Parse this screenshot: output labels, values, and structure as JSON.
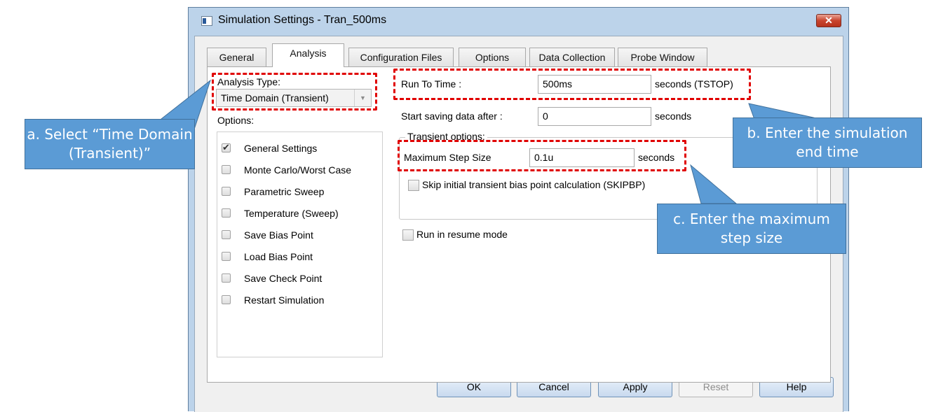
{
  "window": {
    "title": "Simulation Settings - Tran_500ms",
    "close_label": "✕"
  },
  "tabs": [
    {
      "label": "General"
    },
    {
      "label": "Analysis",
      "active": true
    },
    {
      "label": "Configuration Files"
    },
    {
      "label": "Options"
    },
    {
      "label": "Data Collection"
    },
    {
      "label": "Probe Window"
    }
  ],
  "analysis": {
    "type_label": "Analysis Type:",
    "type_value": "Time Domain (Transient)",
    "options_label": "Options:",
    "options": [
      {
        "label": "General Settings",
        "checked": true
      },
      {
        "label": "Monte Carlo/Worst Case",
        "checked": false
      },
      {
        "label": "Parametric Sweep",
        "checked": false
      },
      {
        "label": "Temperature (Sweep)",
        "checked": false
      },
      {
        "label": "Save Bias Point",
        "checked": false
      },
      {
        "label": "Load Bias Point",
        "checked": false
      },
      {
        "label": "Save Check Point",
        "checked": false
      },
      {
        "label": "Restart Simulation",
        "checked": false
      }
    ]
  },
  "settings": {
    "run_to_time_label": "Run To Time :",
    "run_to_time_value": "500ms",
    "run_to_time_unit": "seconds (TSTOP)",
    "start_saving_label": "Start saving data after :",
    "start_saving_value": "0",
    "start_saving_unit": "seconds",
    "transient_group_label": "Transient options:",
    "max_step_label": "Maximum Step Size",
    "max_step_value": "0.1u",
    "max_step_unit": "seconds",
    "skip_bias_label": "Skip initial transient bias point calculation (SKIPBP)",
    "resume_label": "Run in resume mode"
  },
  "buttons": {
    "ok": "OK",
    "cancel": "Cancel",
    "apply": "Apply",
    "reset": "Reset",
    "help": "Help"
  },
  "callouts": {
    "a": "a. Select “Time Domain (Transient)”",
    "b": "b. Enter the simulation end time",
    "c": "c. Enter the maximum step size"
  },
  "colors": {
    "callout_fill": "#5b9bd5",
    "highlight": "#e00000",
    "title_bar": "#bcd3ea"
  }
}
